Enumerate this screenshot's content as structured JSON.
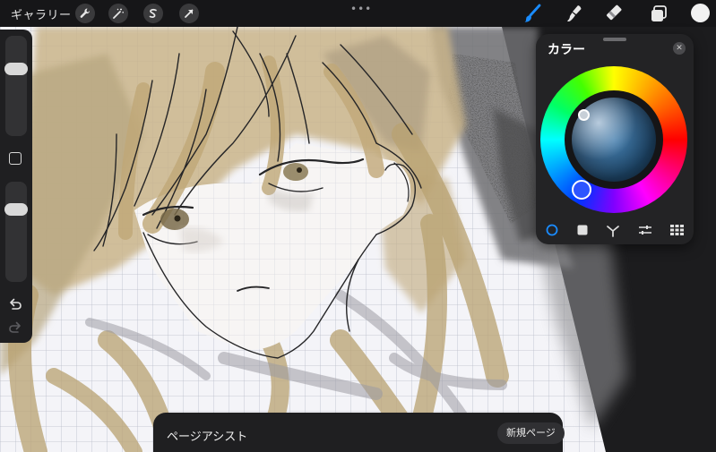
{
  "toolbar": {
    "gallery_label": "ギャラリー",
    "more_label": "•••",
    "left_tools": [
      {
        "name": "actions-wrench-icon"
      },
      {
        "name": "adjustments-magic-wand-icon"
      },
      {
        "name": "selection-s-icon"
      },
      {
        "name": "transform-arrow-icon"
      }
    ],
    "right_tools": [
      {
        "name": "brush-icon",
        "active_color": "#1a8cff"
      },
      {
        "name": "smudge-icon"
      },
      {
        "name": "eraser-icon"
      },
      {
        "name": "layers-icon"
      }
    ],
    "current_color": "#f2f2f2"
  },
  "sidebar": {
    "brush_size": 0.72,
    "brush_opacity": 0.78
  },
  "color_panel": {
    "title": "カラー",
    "close_label": "✕",
    "selected_hue": "#2d55ff",
    "modes": [
      "disc-mode-icon",
      "classic-mode-icon",
      "harmony-mode-icon",
      "value-mode-icon",
      "palettes-mode-icon"
    ],
    "active_mode": "disc-mode-icon"
  },
  "page_assist": {
    "title": "ページアシスト",
    "new_page_label": "新規ページ"
  }
}
